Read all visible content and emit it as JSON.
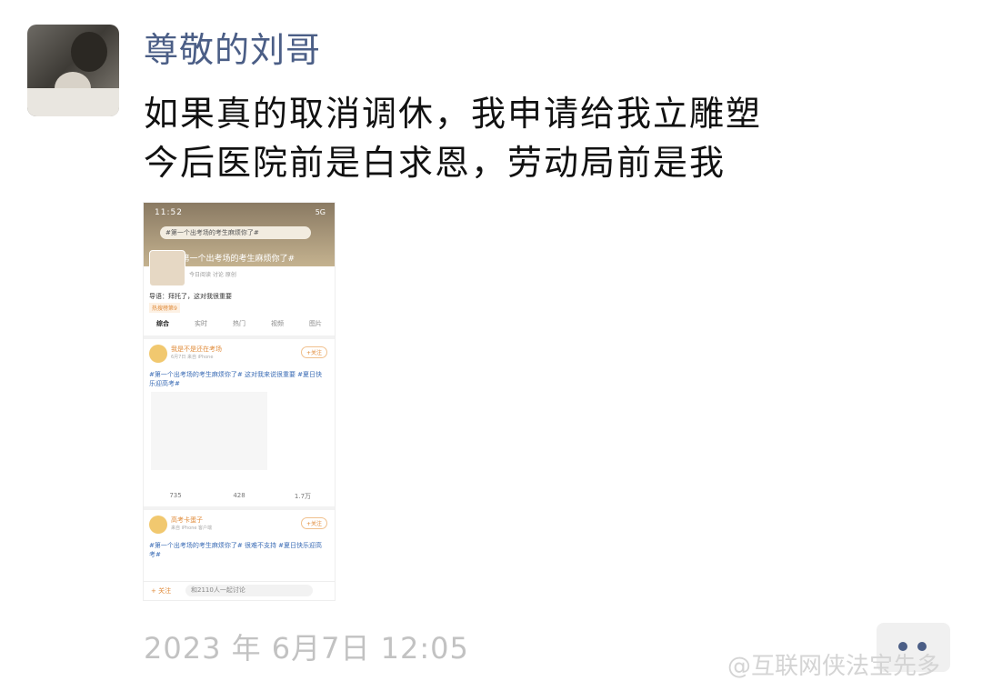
{
  "post": {
    "author": "尊敬的刘哥",
    "lines": [
      "如果真的取消调休，我申请给我立雕塑",
      "今后医院前是白求恩，劳动局前是我"
    ],
    "timestamp": "2023 年 6月7日 12:05"
  },
  "screenshot": {
    "status_time": "11:52",
    "status_right": "5G",
    "search_text": "#第一个出考场的考生麻烦你了#",
    "topic_title": "#第一个出考场的考生麻烦你了#",
    "topic_sub": "今日阅读  讨论  原创",
    "intro": "导语：拜托了，这对我很重要",
    "tag": "热搜榜第9",
    "tabs": [
      "综合",
      "实时",
      "热门",
      "视频",
      "图片"
    ],
    "card1": {
      "name": "我是不是还在考场",
      "info": "6月7日  来自 iPhone",
      "follow": "+关注",
      "text": "#第一个出考场的考生麻烦你了# 这对我来说很重要 #夏日快乐迎高考#",
      "actions": [
        "735",
        "428",
        "1.7万"
      ]
    },
    "card2": {
      "name": "高考卡蛋子",
      "info": "来自 iPhone 客户端",
      "follow": "+关注",
      "text": "#第一个出考场的考生麻烦你了# 很难不支持 #夏日快乐迎高考#"
    },
    "bottom_follow": "+ 关注",
    "bottom_input": "和2110人一起讨论"
  },
  "watermark": "@互联网侠法宝先多"
}
